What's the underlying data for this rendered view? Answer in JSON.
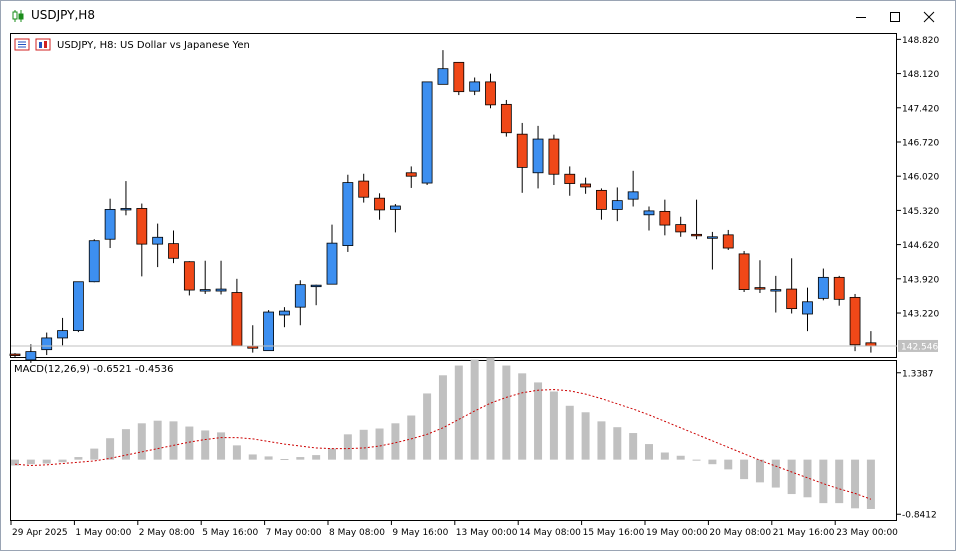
{
  "window": {
    "title": "USDJPY,H8",
    "controls": [
      "minimize-icon",
      "maximize-icon",
      "close-icon"
    ]
  },
  "main_chart": {
    "header_text": "USDJPY, H8:  US Dollar vs Japanese Yen",
    "current_price_label": "142.546",
    "colors": {
      "bull": "#3d8ff0",
      "bear": "#f04818",
      "frame": "#000000",
      "price_line": "#c0c0c0",
      "price_tag_bg": "#c0c0c0"
    }
  },
  "macd_panel": {
    "header_text": "MACD(12,26,9) -0.6521 -0.4536",
    "colors": {
      "histogram": "#c0c0c0",
      "signal": "#cc0000"
    }
  },
  "chart_data": [
    {
      "type": "candlestick",
      "title": "USDJPY, H8:  US Dollar vs Japanese Yen",
      "ylim": [
        142.32,
        148.93
      ],
      "y_ticks": [
        "148.820",
        "148.120",
        "147.420",
        "146.720",
        "146.020",
        "145.320",
        "144.620",
        "143.920",
        "143.220"
      ],
      "current_price": 142.546,
      "x_tick_labels": [
        "29 Apr 2025",
        "1 May 00:00",
        "2 May 08:00",
        "5 May 16:00",
        "7 May 00:00",
        "8 May 08:00",
        "9 May 16:00",
        "13 May 00:00",
        "14 May 08:00",
        "15 May 16:00",
        "19 May 00:00",
        "20 May 08:00",
        "21 May 16:00",
        "23 May 00:00"
      ],
      "candles": [
        {
          "o": 142.38,
          "h": 142.4,
          "l": 142.32,
          "c": 142.35
        },
        {
          "o": 142.26,
          "h": 142.58,
          "l": 142.2,
          "c": 142.43
        },
        {
          "o": 142.47,
          "h": 142.82,
          "l": 142.36,
          "c": 142.71
        },
        {
          "o": 142.71,
          "h": 143.12,
          "l": 142.56,
          "c": 142.86
        },
        {
          "o": 142.86,
          "h": 143.86,
          "l": 142.83,
          "c": 143.86
        },
        {
          "o": 143.86,
          "h": 144.73,
          "l": 143.85,
          "c": 144.7
        },
        {
          "o": 144.73,
          "h": 145.56,
          "l": 144.55,
          "c": 145.34
        },
        {
          "o": 145.33,
          "h": 145.92,
          "l": 145.22,
          "c": 145.36
        },
        {
          "o": 145.36,
          "h": 145.46,
          "l": 143.97,
          "c": 144.63
        },
        {
          "o": 144.63,
          "h": 145.05,
          "l": 144.16,
          "c": 144.77
        },
        {
          "o": 144.64,
          "h": 144.91,
          "l": 144.24,
          "c": 144.34
        },
        {
          "o": 144.27,
          "h": 144.28,
          "l": 143.58,
          "c": 143.69
        },
        {
          "o": 143.67,
          "h": 144.29,
          "l": 143.61,
          "c": 143.7
        },
        {
          "o": 143.67,
          "h": 144.29,
          "l": 143.6,
          "c": 143.71
        },
        {
          "o": 143.64,
          "h": 143.92,
          "l": 142.54,
          "c": 142.55
        },
        {
          "o": 142.54,
          "h": 142.97,
          "l": 142.41,
          "c": 142.5
        },
        {
          "o": 142.45,
          "h": 143.28,
          "l": 142.45,
          "c": 143.24
        },
        {
          "o": 143.18,
          "h": 143.34,
          "l": 142.93,
          "c": 143.26
        },
        {
          "o": 143.34,
          "h": 143.89,
          "l": 142.97,
          "c": 143.8
        },
        {
          "o": 143.78,
          "h": 143.8,
          "l": 143.38,
          "c": 143.79
        },
        {
          "o": 143.81,
          "h": 145.03,
          "l": 143.81,
          "c": 144.65
        },
        {
          "o": 144.6,
          "h": 146.05,
          "l": 144.47,
          "c": 145.89
        },
        {
          "o": 145.92,
          "h": 146.07,
          "l": 145.48,
          "c": 145.59
        },
        {
          "o": 145.57,
          "h": 145.67,
          "l": 145.13,
          "c": 145.33
        },
        {
          "o": 145.34,
          "h": 145.45,
          "l": 144.87,
          "c": 145.41
        },
        {
          "o": 146.09,
          "h": 146.22,
          "l": 145.78,
          "c": 146.02
        },
        {
          "o": 145.88,
          "h": 147.95,
          "l": 145.84,
          "c": 147.95
        },
        {
          "o": 147.9,
          "h": 148.6,
          "l": 147.9,
          "c": 148.22
        },
        {
          "o": 148.35,
          "h": 148.31,
          "l": 147.68,
          "c": 147.75
        },
        {
          "o": 147.76,
          "h": 148.04,
          "l": 147.68,
          "c": 147.95
        },
        {
          "o": 147.95,
          "h": 148.12,
          "l": 147.41,
          "c": 147.48
        },
        {
          "o": 147.49,
          "h": 147.58,
          "l": 146.83,
          "c": 146.91
        },
        {
          "o": 146.88,
          "h": 147.11,
          "l": 145.68,
          "c": 146.2
        },
        {
          "o": 146.09,
          "h": 147.05,
          "l": 145.77,
          "c": 146.78
        },
        {
          "o": 146.78,
          "h": 146.87,
          "l": 145.84,
          "c": 146.06
        },
        {
          "o": 146.06,
          "h": 146.22,
          "l": 145.62,
          "c": 145.87
        },
        {
          "o": 145.86,
          "h": 145.99,
          "l": 145.66,
          "c": 145.8
        },
        {
          "o": 145.73,
          "h": 145.77,
          "l": 145.13,
          "c": 145.34
        },
        {
          "o": 145.34,
          "h": 145.79,
          "l": 145.1,
          "c": 145.52
        },
        {
          "o": 145.55,
          "h": 146.13,
          "l": 145.4,
          "c": 145.7
        },
        {
          "o": 145.23,
          "h": 145.4,
          "l": 144.91,
          "c": 145.31
        },
        {
          "o": 145.3,
          "h": 145.54,
          "l": 144.81,
          "c": 145.02
        },
        {
          "o": 145.03,
          "h": 145.19,
          "l": 144.78,
          "c": 144.88
        },
        {
          "o": 144.83,
          "h": 145.54,
          "l": 144.73,
          "c": 144.8
        },
        {
          "o": 144.76,
          "h": 144.88,
          "l": 144.11,
          "c": 144.78
        },
        {
          "o": 144.82,
          "h": 144.92,
          "l": 144.51,
          "c": 144.55
        },
        {
          "o": 144.43,
          "h": 144.49,
          "l": 143.65,
          "c": 143.7
        },
        {
          "o": 143.74,
          "h": 144.3,
          "l": 143.63,
          "c": 143.72
        },
        {
          "o": 143.69,
          "h": 143.98,
          "l": 143.23,
          "c": 143.7
        },
        {
          "o": 143.71,
          "h": 144.34,
          "l": 143.21,
          "c": 143.31
        },
        {
          "o": 143.2,
          "h": 143.74,
          "l": 142.85,
          "c": 143.45
        },
        {
          "o": 143.52,
          "h": 144.13,
          "l": 143.48,
          "c": 143.95
        },
        {
          "o": 143.95,
          "h": 143.98,
          "l": 143.37,
          "c": 143.5
        },
        {
          "o": 143.54,
          "h": 143.61,
          "l": 142.44,
          "c": 142.57
        },
        {
          "o": 142.61,
          "h": 142.85,
          "l": 142.41,
          "c": 142.546
        }
      ]
    },
    {
      "type": "bar",
      "title": "MACD(12,26,9) -0.6521 -0.4536",
      "ylim": [
        -0.93,
        1.52
      ],
      "y_ticks": [
        "1.3387",
        "-0.8412"
      ],
      "macd_values": [
        -0.09,
        -0.07,
        -0.06,
        -0.04,
        0.04,
        0.17,
        0.33,
        0.47,
        0.56,
        0.6,
        0.59,
        0.51,
        0.45,
        0.42,
        0.22,
        0.08,
        0.05,
        0.01,
        0.04,
        0.07,
        0.17,
        0.39,
        0.46,
        0.48,
        0.56,
        0.68,
        1.02,
        1.3,
        1.45,
        1.54,
        1.57,
        1.45,
        1.33,
        1.19,
        1.05,
        0.83,
        0.73,
        0.59,
        0.5,
        0.41,
        0.24,
        0.11,
        0.06,
        -0.01,
        -0.07,
        -0.15,
        -0.3,
        -0.35,
        -0.43,
        -0.53,
        -0.58,
        -0.67,
        -0.67,
        -0.75,
        -0.76
      ],
      "signal_values": [
        -0.07,
        -0.09,
        -0.08,
        -0.06,
        -0.04,
        -0.02,
        0.02,
        0.07,
        0.12,
        0.17,
        0.22,
        0.27,
        0.31,
        0.34,
        0.34,
        0.32,
        0.28,
        0.24,
        0.21,
        0.18,
        0.17,
        0.17,
        0.18,
        0.21,
        0.26,
        0.32,
        0.39,
        0.49,
        0.62,
        0.75,
        0.87,
        0.96,
        1.03,
        1.07,
        1.08,
        1.06,
        1.01,
        0.94,
        0.86,
        0.78,
        0.69,
        0.59,
        0.49,
        0.39,
        0.29,
        0.19,
        0.09,
        -0.01,
        -0.1,
        -0.19,
        -0.28,
        -0.37,
        -0.45,
        -0.52,
        -0.61
      ]
    }
  ]
}
